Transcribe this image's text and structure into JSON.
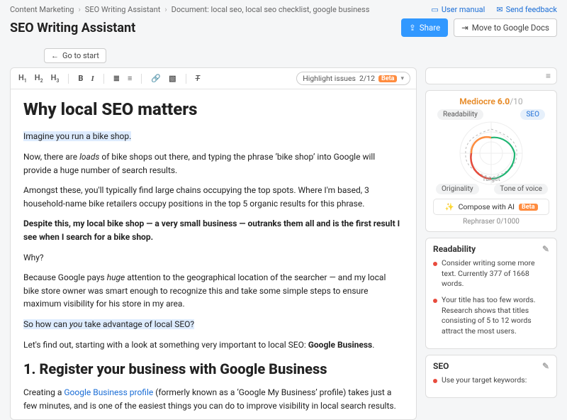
{
  "breadcrumb": {
    "item0": "Content Marketing",
    "item1": "SEO Writing Assistant",
    "item2": "Document: local seo, local seo checklist, google business"
  },
  "topLinks": {
    "userManual": "User manual",
    "sendFeedback": "Send feedback"
  },
  "pageTitle": "SEO Writing Assistant",
  "actions": {
    "share": "Share",
    "export": "Move to Google Docs",
    "back": "Go to start"
  },
  "toolbar": {
    "highlightLabel": "Highlight issues",
    "highlightCount": "2/12",
    "beta": "Beta"
  },
  "doc": {
    "h1": "Why local SEO matters",
    "p1": "Imagine you run a bike shop.",
    "p2a": "Now, there are ",
    "p2b": "loads",
    "p2c": " of bike shops out there, and typing the phrase ‘bike shop’ into Google will provide a huge number of search results.",
    "p3": "Amongst these, you'll typically find large chains occupying the top spots. Where I'm based, 3 household-name bike retailers occupy positions in the top 5 organic results for this phrase.",
    "p4": "Despite this, my local bike shop — a very small business — outranks them all and is the first result I see when I search for a bike shop.",
    "p5": "Why?",
    "p6a": "Because Google pays ",
    "p6b": "huge",
    "p6c": " attention to the geographical location of the searcher — and my local bike store owner was smart enough to recognize this and take some simple steps to ensure maximum visibility for his store in my area.",
    "p7a": "So how can ",
    "p7b": "you",
    "p7c": " take advantage of local SEO?",
    "p8a": "Let's find out, starting with a look at something very important to local SEO: ",
    "p8b": "Google Business",
    "p8c": ".",
    "h2": "1. Register your business with Google Business",
    "p9a": "Creating a ",
    "p9b": "Google Business profile",
    "p9c": " (formerly known as a ‘Google My Business’ profile) takes just a few minutes, and is one of the easiest things you can do to improve visibility in local search results."
  },
  "score": {
    "label": "Mediocre",
    "value": "6.0",
    "max": "/10",
    "axisReadability": "Readability",
    "axisSEO": "SEO",
    "axisOriginality": "Originality",
    "axisTone": "Tone of voice",
    "target": "Target",
    "compose": "Compose with AI",
    "composeBadge": "Beta",
    "rephraser": "Rephraser  0/1000"
  },
  "readability": {
    "title": "Readability",
    "tip1": "Consider writing some more text. Currently 377 of 1668 words.",
    "tip2": "Your title has too few words. Research shows that titles consisting of 5 to 12 words attract the most users."
  },
  "seo": {
    "title": "SEO",
    "tip1": "Use your target keywords:"
  }
}
